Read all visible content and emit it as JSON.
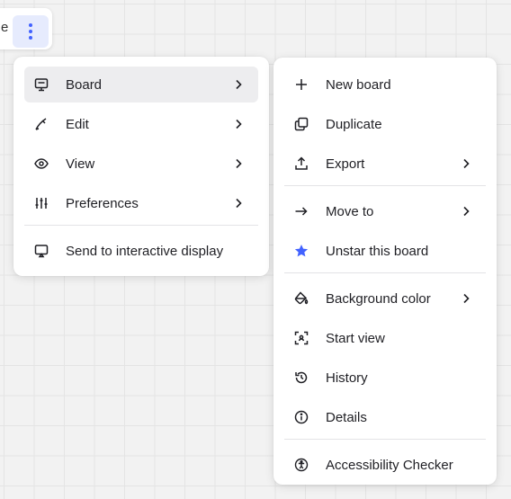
{
  "topbar": {
    "partial_label": "e",
    "more_button": "more-options"
  },
  "main_menu": {
    "items": [
      {
        "label": "Board",
        "icon": "board-icon",
        "has_submenu": true,
        "active": true
      },
      {
        "label": "Edit",
        "icon": "pen-icon",
        "has_submenu": true
      },
      {
        "label": "View",
        "icon": "eye-icon",
        "has_submenu": true
      },
      {
        "label": "Preferences",
        "icon": "sliders-icon",
        "has_submenu": true
      }
    ],
    "footer_item": {
      "label": "Send to interactive display",
      "icon": "display-icon"
    }
  },
  "board_submenu": {
    "group1": [
      {
        "label": "New board",
        "icon": "plus-icon"
      },
      {
        "label": "Duplicate",
        "icon": "duplicate-icon"
      },
      {
        "label": "Export",
        "icon": "export-icon",
        "has_submenu": true
      }
    ],
    "group2": [
      {
        "label": "Move to",
        "icon": "arrow-right-icon",
        "has_submenu": true
      },
      {
        "label": "Unstar this board",
        "icon": "star-icon",
        "accent": "#4262ff"
      }
    ],
    "group3": [
      {
        "label": "Background color",
        "icon": "paint-bucket-icon",
        "has_submenu": true
      },
      {
        "label": "Start view",
        "icon": "frame-icon"
      },
      {
        "label": "History",
        "icon": "history-icon"
      },
      {
        "label": "Details",
        "icon": "info-icon"
      }
    ],
    "group4": [
      {
        "label": "Accessibility Checker",
        "icon": "accessibility-icon"
      }
    ]
  },
  "colors": {
    "accent": "#4262ff",
    "active_bg": "#ededef",
    "kebab_bg": "#e6ebfd"
  }
}
